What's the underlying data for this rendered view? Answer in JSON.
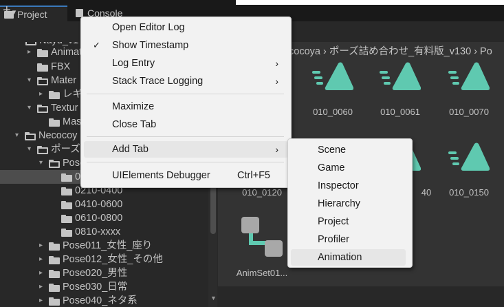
{
  "tabs": [
    {
      "label": "Project",
      "icon": "folder-icon"
    },
    {
      "label": "Console",
      "icon": "console-icon"
    }
  ],
  "toolbar": {
    "add_label": "+",
    "add_dropdown": "▾"
  },
  "breadcrumb": "cocoya › ポーズ詰め合わせ_有料版_v130 › Po",
  "tree": {
    "rows": [
      {
        "label": "Nayu_v1",
        "arrow": "▾",
        "open": true
      },
      {
        "label": "Animat",
        "arrow": "▸",
        "open": false
      },
      {
        "label": "FBX",
        "arrow": "",
        "open": false
      },
      {
        "label": "Mater",
        "arrow": "▾",
        "open": true
      },
      {
        "label": "レギ",
        "arrow": "▸",
        "open": false
      },
      {
        "label": "Textur",
        "arrow": "▾",
        "open": true
      },
      {
        "label": "Mas",
        "arrow": "",
        "open": false
      },
      {
        "label": "Necocoy",
        "arrow": "▾",
        "open": true
      },
      {
        "label": "ポーズ詰",
        "arrow": "▾",
        "open": true
      },
      {
        "label": "Pose",
        "arrow": "▾",
        "open": true
      },
      {
        "label": "0",
        "arrow": "",
        "open": false
      },
      {
        "label": "0210-0400",
        "arrow": "",
        "open": false
      },
      {
        "label": "0410-0600",
        "arrow": "",
        "open": false
      },
      {
        "label": "0610-0800",
        "arrow": "",
        "open": false
      },
      {
        "label": "0810-xxxx",
        "arrow": "",
        "open": false
      },
      {
        "label": "Pose011_女性_座り",
        "arrow": "▸",
        "open": false
      },
      {
        "label": "Pose012_女性_その他",
        "arrow": "▸",
        "open": false
      },
      {
        "label": "Pose020_男性",
        "arrow": "▸",
        "open": false
      },
      {
        "label": "Pose030_日常",
        "arrow": "▸",
        "open": false
      },
      {
        "label": "Pose040_ネタ系",
        "arrow": "▸",
        "open": false
      }
    ]
  },
  "assets": [
    {
      "label": "010_0060",
      "icon": "animation-clip-icon"
    },
    {
      "label": "010_0061",
      "icon": "animation-clip-icon"
    },
    {
      "label": "010_0070",
      "icon": "animation-clip-icon"
    },
    {
      "label": "010_0120",
      "icon": "animation-clip-icon"
    },
    {
      "label": "40",
      "icon": "animation-clip-icon"
    },
    {
      "label": "010_0150",
      "icon": "animation-clip-icon"
    },
    {
      "label": "AnimSet01...",
      "icon": "animator-controller-icon"
    }
  ],
  "context_menu": {
    "items": [
      {
        "label": "Open Editor Log"
      },
      {
        "label": "Show Timestamp",
        "checked": "✓"
      },
      {
        "label": "Log Entry",
        "submenu": "›"
      },
      {
        "label": "Stack Trace Logging",
        "submenu": "›"
      },
      {
        "label": "Maximize"
      },
      {
        "label": "Close Tab"
      },
      {
        "label": "Add Tab",
        "submenu": "›"
      },
      {
        "label": "UIElements Debugger",
        "shortcut": "Ctrl+F5"
      }
    ]
  },
  "add_tab_submenu": {
    "items": [
      {
        "label": "Scene"
      },
      {
        "label": "Game"
      },
      {
        "label": "Inspector"
      },
      {
        "label": "Hierarchy"
      },
      {
        "label": "Project"
      },
      {
        "label": "Profiler"
      },
      {
        "label": "Animation"
      }
    ]
  },
  "colors": {
    "clip_accent": "#5fc9b0",
    "menu_bg": "#f2f2f2",
    "highlight": "#e6e6e6",
    "selected_row": "#4d4d4d",
    "tab_underline": "#3a79bb"
  }
}
